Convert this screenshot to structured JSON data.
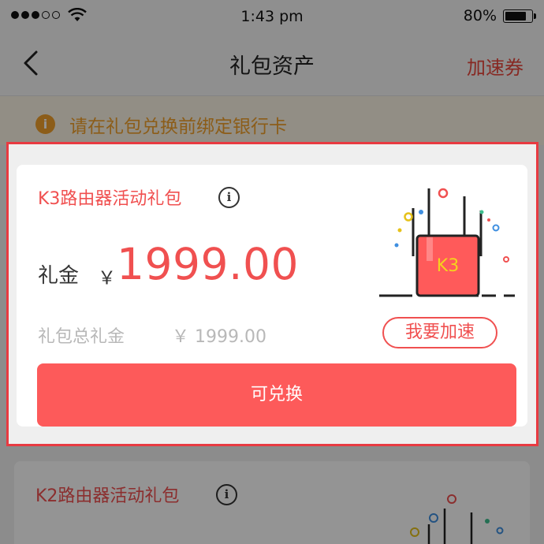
{
  "status_bar": {
    "time": "1:43 pm",
    "battery": "80%",
    "battery_level": 0.8
  },
  "nav": {
    "title": "礼包资产",
    "right_link": "加速券"
  },
  "notice": {
    "icon": "i",
    "text": "请在礼包兑换前绑定银行卡"
  },
  "packages": [
    {
      "title": "K3路由器活动礼包",
      "info_icon": "i",
      "amount_label": "礼金",
      "currency": "￥",
      "amount": "1999.00",
      "total_label": "礼包总礼金",
      "total_value": "￥ 1999.00",
      "speed_button": "我要加速",
      "exchange_button": "可兑换",
      "router_label": "K3"
    },
    {
      "title": "K2路由器活动礼包",
      "info_icon": "i"
    }
  ],
  "colors": {
    "accent": "#f05050",
    "button": "#fd5a5a",
    "highlight_border": "#e83a41",
    "notice": "#f2a12b"
  }
}
